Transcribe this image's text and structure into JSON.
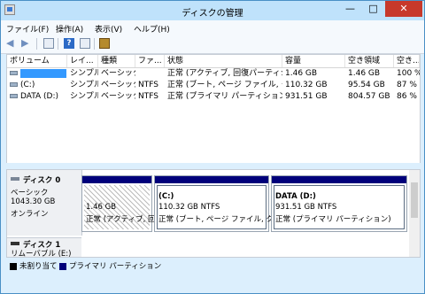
{
  "window": {
    "title": "ディスクの管理",
    "controls": {
      "minimize": "—",
      "maximize": "□",
      "close": "✕"
    }
  },
  "menu": [
    "ファイル(F)",
    "操作(A)",
    "表示(V)",
    "ヘルプ(H)"
  ],
  "toolbar": {
    "help": "?"
  },
  "columns": [
    "ボリューム",
    "レイ...",
    "種類",
    "ファ...",
    "状態",
    "容量",
    "空き領域",
    "空き..."
  ],
  "rows": [
    {
      "volume": "",
      "layout": "シンプル",
      "type": "ベーシック",
      "fs": "",
      "status": "正常 (アクティブ, 回復パーティシ...",
      "capacity": "1.46 GB",
      "free": "1.46 GB",
      "pct": "100 %"
    },
    {
      "volume": "(C:)",
      "layout": "シンプル",
      "type": "ベーシック",
      "fs": "NTFS",
      "status": "正常 (ブート, ページ ファイル, ク...",
      "capacity": "110.32 GB",
      "free": "95.54 GB",
      "pct": "87 %"
    },
    {
      "volume": "DATA (D:)",
      "layout": "シンプル",
      "type": "ベーシック",
      "fs": "NTFS",
      "status": "正常 (プライマリ パーティション)",
      "capacity": "931.51 GB",
      "free": "804.57 GB",
      "pct": "86 %"
    }
  ],
  "disk0": {
    "name": "ディスク 0",
    "type": "ベーシック",
    "size": "1043.30 GB",
    "state": "オンライン",
    "partitions": [
      {
        "label": "",
        "size": "1.46 GB",
        "status": "正常 (アクティブ, 回"
      },
      {
        "label": "(C:)",
        "size": "110.32 GB NTFS",
        "status": "正常 (ブート, ページ ファイル, クラ"
      },
      {
        "label": "DATA  (D:)",
        "size": "931.51 GB NTFS",
        "status": "正常 (プライマリ パーティション)"
      }
    ]
  },
  "disk1": {
    "name": "ディスク 1",
    "type": "リムーバブル (E:)"
  },
  "legend": [
    {
      "label": "未割り当て",
      "color": "#000000"
    },
    {
      "label": "プライマリ パーティション",
      "color": "#00007a"
    }
  ]
}
